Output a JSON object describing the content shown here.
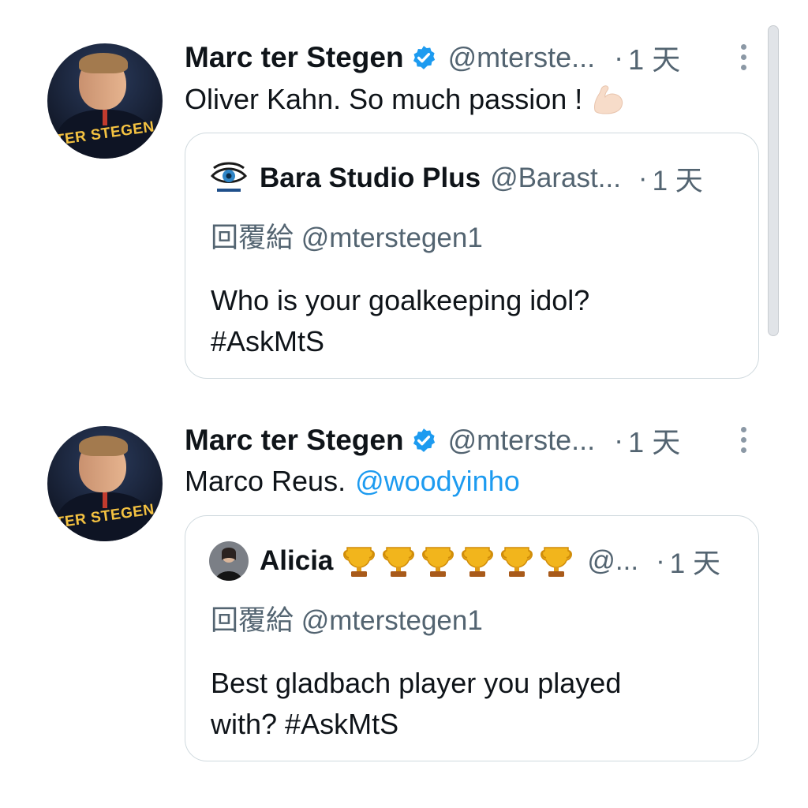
{
  "tweets": [
    {
      "author": {
        "name": "Marc ter Stegen",
        "handle": "@mterste...",
        "avatar_text": "TER STEGEN"
      },
      "time": "1 天",
      "text": "Oliver Kahn.  So much passion !",
      "emoji": "flexed-biceps-emoji",
      "quote": {
        "author": {
          "name": "Bara Studio Plus",
          "handle": "@Barast..."
        },
        "time": "1 天",
        "reply_to": "回覆給 @mterstegen1",
        "text_lines": [
          "Who is your goalkeeping idol?",
          "#AskMtS"
        ]
      }
    },
    {
      "author": {
        "name": "Marc ter Stegen",
        "handle": "@mterste...",
        "avatar_text": "TER STEGEN"
      },
      "time": "1 天",
      "text": "Marco Reus.",
      "mention": "@woodyinho",
      "quote": {
        "author": {
          "name": "Alicia",
          "handle": "@...",
          "trophy_count": 6
        },
        "time": "1 天",
        "reply_to": "回覆給 @mterstegen1",
        "text_lines": [
          "Best gladbach player you played",
          "with? #AskMtS"
        ]
      }
    }
  ],
  "separator": "·",
  "colors": {
    "text": "#0f1419",
    "secondary": "#536471",
    "link": "#1d9bf0",
    "verified": "#1d9bf0",
    "border": "#cfd9de"
  }
}
